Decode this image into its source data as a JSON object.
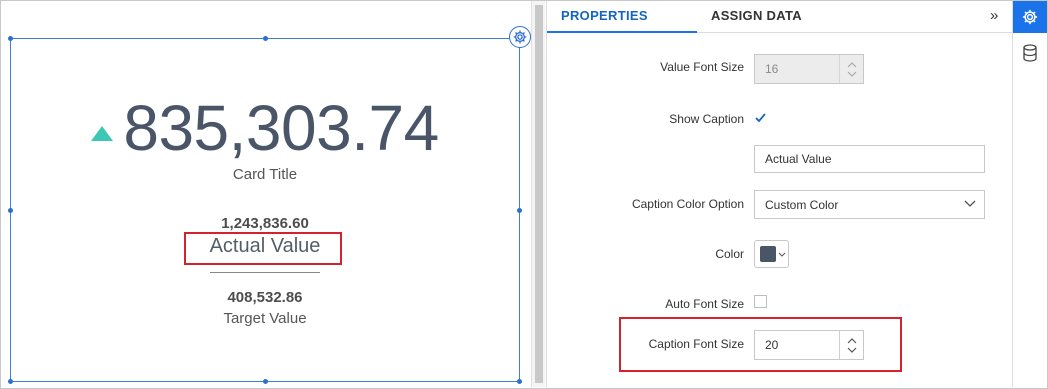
{
  "card": {
    "kpi_value": "835,303.74",
    "title": "Card Title",
    "actual_number": "1,243,836.60",
    "actual_caption": "Actual Value",
    "target_number": "408,532.86",
    "target_caption": "Target Value",
    "trend_icon": "triangle-up-icon",
    "trend_color": "#3cc8b4",
    "value_color": "#4a5568"
  },
  "panel": {
    "tabs": [
      {
        "label": "PROPERTIES",
        "active": true
      },
      {
        "label": "ASSIGN DATA",
        "active": false
      }
    ],
    "collapse_glyph": "»",
    "value_font_size": {
      "label": "Value Font Size",
      "value": "16"
    },
    "show_caption": {
      "label": "Show Caption",
      "checked": true
    },
    "caption_text": {
      "value": "Actual Value"
    },
    "caption_color_option": {
      "label": "Caption Color Option",
      "value": "Custom Color"
    },
    "color": {
      "label": "Color",
      "value": "#4a5568"
    },
    "auto_font_size": {
      "label": "Auto Font Size",
      "checked": false
    },
    "caption_font_size": {
      "label": "Caption Font Size",
      "value": "20"
    }
  },
  "rail": {
    "items": [
      {
        "icon": "gear-icon",
        "active": true
      },
      {
        "icon": "database-icon",
        "active": false
      }
    ]
  },
  "colors": {
    "accent": "#1a73e8",
    "highlight_border": "#d3242c"
  }
}
